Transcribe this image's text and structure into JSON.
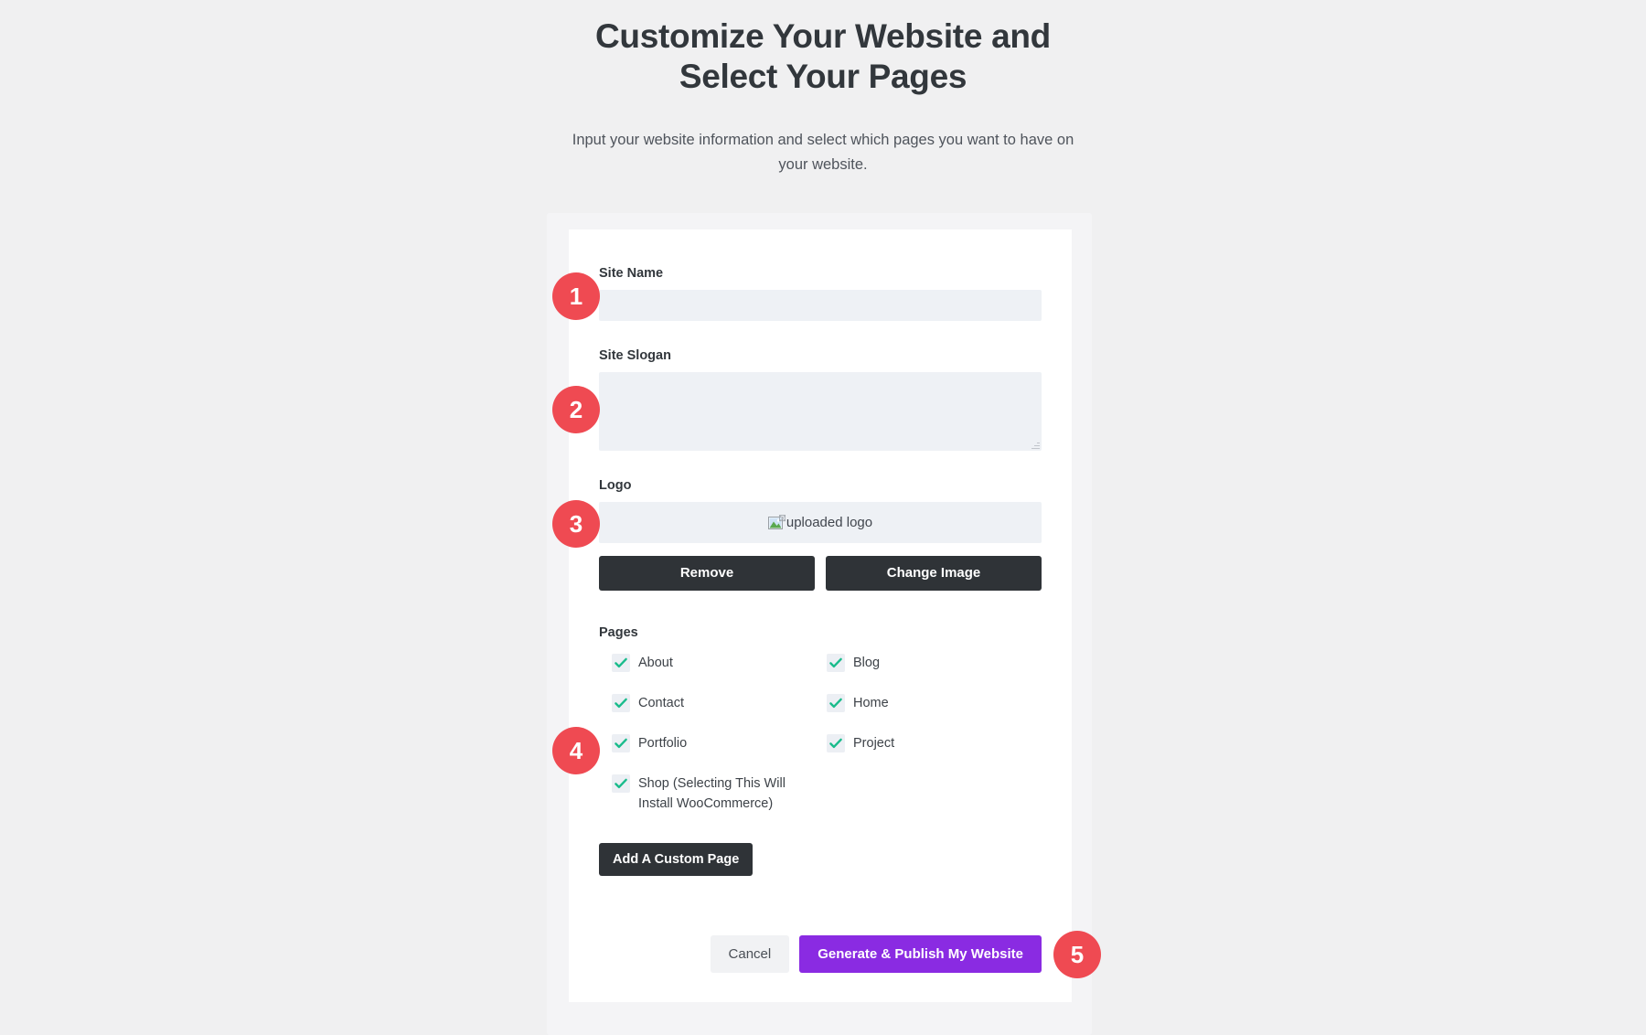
{
  "header": {
    "title": "Customize Your Website and Select Your Pages",
    "subtitle": "Input your website information and select which pages you want to have on your website."
  },
  "form": {
    "site_name": {
      "label": "Site Name",
      "value": "",
      "placeholder": ""
    },
    "site_slogan": {
      "label": "Site Slogan",
      "value": "",
      "placeholder": ""
    },
    "logo": {
      "label": "Logo",
      "alt_text": "uploaded logo",
      "icon": "broken-image-icon",
      "remove_label": "Remove",
      "change_label": "Change Image"
    },
    "pages": {
      "label": "Pages",
      "items": [
        {
          "label": "About",
          "checked": true
        },
        {
          "label": "Blog",
          "checked": true
        },
        {
          "label": "Contact",
          "checked": true
        },
        {
          "label": "Home",
          "checked": true
        },
        {
          "label": "Portfolio",
          "checked": true
        },
        {
          "label": "Project",
          "checked": true
        },
        {
          "label": "Shop (Selecting This Will Install WooCommerce)",
          "checked": true
        }
      ],
      "add_custom_page_label": "Add A Custom Page"
    },
    "actions": {
      "cancel_label": "Cancel",
      "publish_label": "Generate & Publish My Website"
    }
  },
  "badges": [
    {
      "number": "1"
    },
    {
      "number": "2"
    },
    {
      "number": "3"
    },
    {
      "number": "4"
    },
    {
      "number": "5"
    }
  ],
  "colors": {
    "page_background": "#f0f0f1",
    "card_background": "#ffffff",
    "input_background": "#eef1f5",
    "dark_button": "#2f3337",
    "accent_purple": "#8a2be2",
    "badge_red": "#ef4a52",
    "check_green": "#1abc8c",
    "text_primary": "#32373c"
  }
}
